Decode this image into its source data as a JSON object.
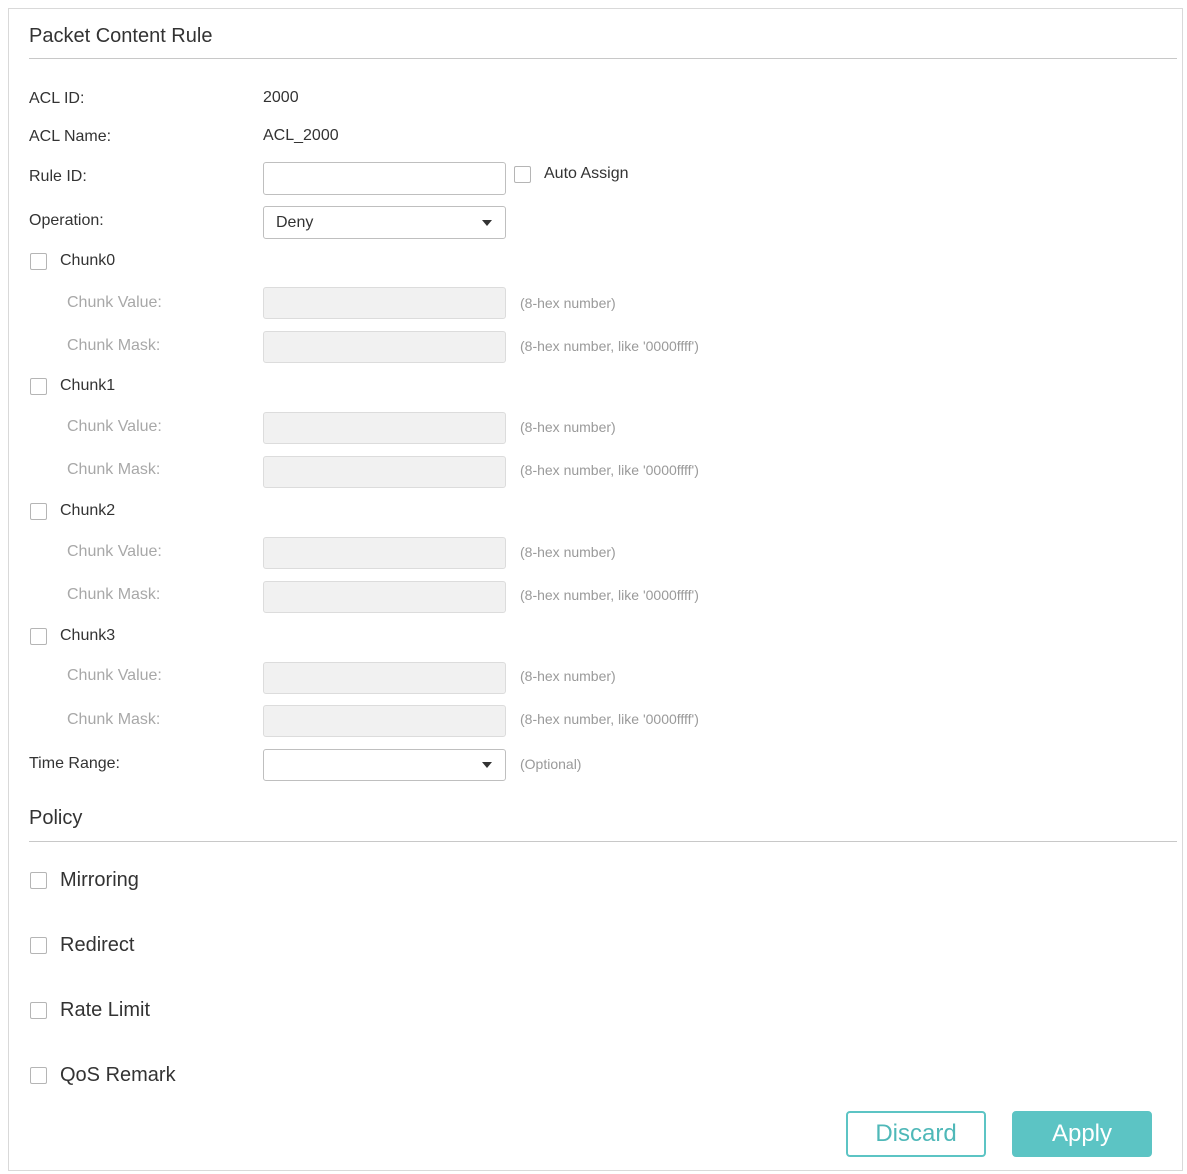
{
  "form": {
    "title": "Packet Content Rule",
    "acl_id_label": "ACL ID:",
    "acl_id_value": "2000",
    "acl_name_label": "ACL Name:",
    "acl_name_value": "ACL_2000",
    "rule_id_label": "Rule ID:",
    "rule_id_value": "",
    "auto_assign_label": "Auto Assign",
    "operation_label": "Operation:",
    "operation_value": "Deny",
    "time_range_label": "Time Range:",
    "time_range_value": "",
    "time_range_hint": "(Optional)"
  },
  "chunks": [
    {
      "label": "Chunk0",
      "value_label": "Chunk Value:",
      "mask_label": "Chunk Mask:",
      "value_hint": "(8-hex number)",
      "mask_hint": "(8-hex number, like '0000ffff')"
    },
    {
      "label": "Chunk1",
      "value_label": "Chunk Value:",
      "mask_label": "Chunk Mask:",
      "value_hint": "(8-hex number)",
      "mask_hint": "(8-hex number, like '0000ffff')"
    },
    {
      "label": "Chunk2",
      "value_label": "Chunk Value:",
      "mask_label": "Chunk Mask:",
      "value_hint": "(8-hex number)",
      "mask_hint": "(8-hex number, like '0000ffff')"
    },
    {
      "label": "Chunk3",
      "value_label": "Chunk Value:",
      "mask_label": "Chunk Mask:",
      "value_hint": "(8-hex number)",
      "mask_hint": "(8-hex number, like '0000ffff')"
    }
  ],
  "policy": {
    "title": "Policy",
    "items": [
      "Mirroring",
      "Redirect",
      "Rate Limit",
      "QoS Remark"
    ]
  },
  "actions": {
    "discard_label": "Discard",
    "apply_label": "Apply"
  },
  "colors": {
    "accent": "#5cc4c4",
    "border": "#bfbfbf",
    "disabled_bg": "#f1f1f1"
  }
}
